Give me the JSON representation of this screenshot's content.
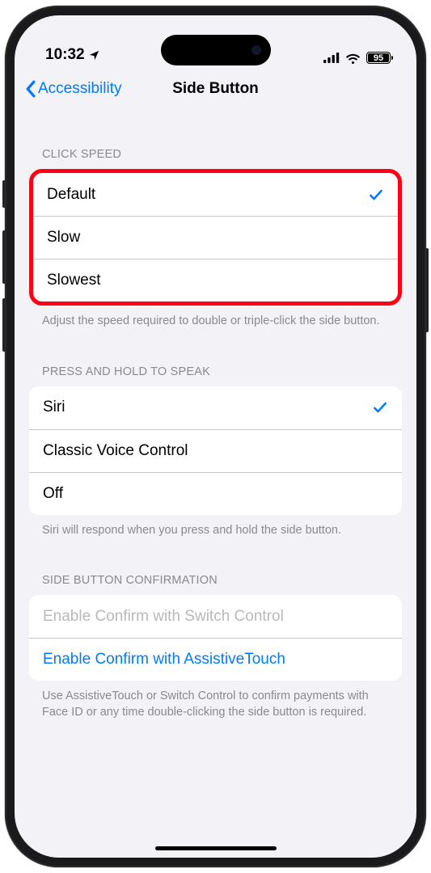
{
  "status": {
    "time": "10:32",
    "battery": "95"
  },
  "nav": {
    "back": "Accessibility",
    "title": "Side Button"
  },
  "sections": {
    "clickSpeed": {
      "header": "CLICK SPEED",
      "options": [
        "Default",
        "Slow",
        "Slowest"
      ],
      "selectedIndex": 0,
      "footer": "Adjust the speed required to double or triple-click the side button."
    },
    "pressHold": {
      "header": "PRESS AND HOLD TO SPEAK",
      "options": [
        "Siri",
        "Classic Voice Control",
        "Off"
      ],
      "selectedIndex": 0,
      "footer": "Siri will respond when you press and hold the side button."
    },
    "confirm": {
      "header": "SIDE BUTTON CONFIRMATION",
      "options": [
        "Enable Confirm with Switch Control",
        "Enable Confirm with AssistiveTouch"
      ],
      "enabledIndex": 1,
      "footer": "Use AssistiveTouch or Switch Control to confirm payments with Face ID or any time double-clicking the side button is required."
    }
  }
}
